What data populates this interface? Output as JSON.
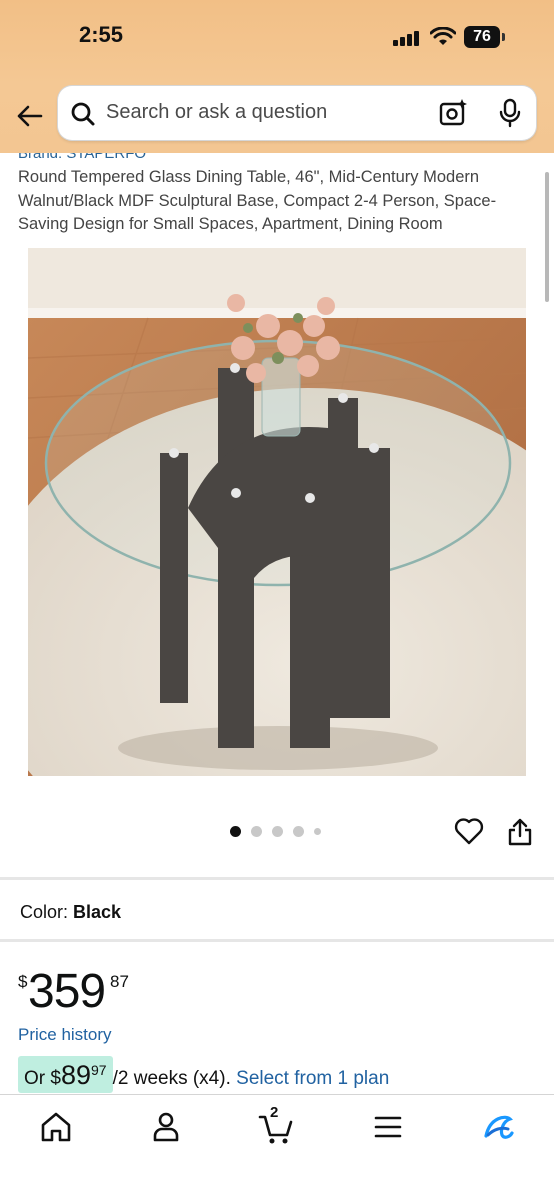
{
  "status": {
    "time": "2:55",
    "battery": "76"
  },
  "search": {
    "placeholder": "Search or ask a question"
  },
  "product": {
    "brand": "Brand: STAPERFO",
    "title": "Round Tempered Glass Dining Table, 46\", Mid-Century Modern Walnut/Black MDF Sculptural Base, Compact 2-4 Person, Space-Saving Design for Small Spaces, Apartment, Dining Room",
    "image_count": 5,
    "active_image": 1
  },
  "color": {
    "label": "Color:",
    "value": "Black"
  },
  "price": {
    "symbol": "$",
    "whole": "359",
    "cents": "87",
    "history_link": "Price history"
  },
  "installment": {
    "prefix": "Or ",
    "symbol": "$",
    "whole": "89",
    "cents": "97",
    "suffix": "/2 weeks (x4). ",
    "link": "Select from 1 plan"
  },
  "bottom_nav": {
    "items": [
      "home-icon",
      "account-icon",
      "cart-icon",
      "menu-icon",
      "rufus-icon"
    ],
    "cart_count": "2"
  },
  "colors": {
    "header": "#f3c28b",
    "link": "#2162a1",
    "plan_bg": "#bfeee0",
    "rufus": "#1a98ff"
  }
}
